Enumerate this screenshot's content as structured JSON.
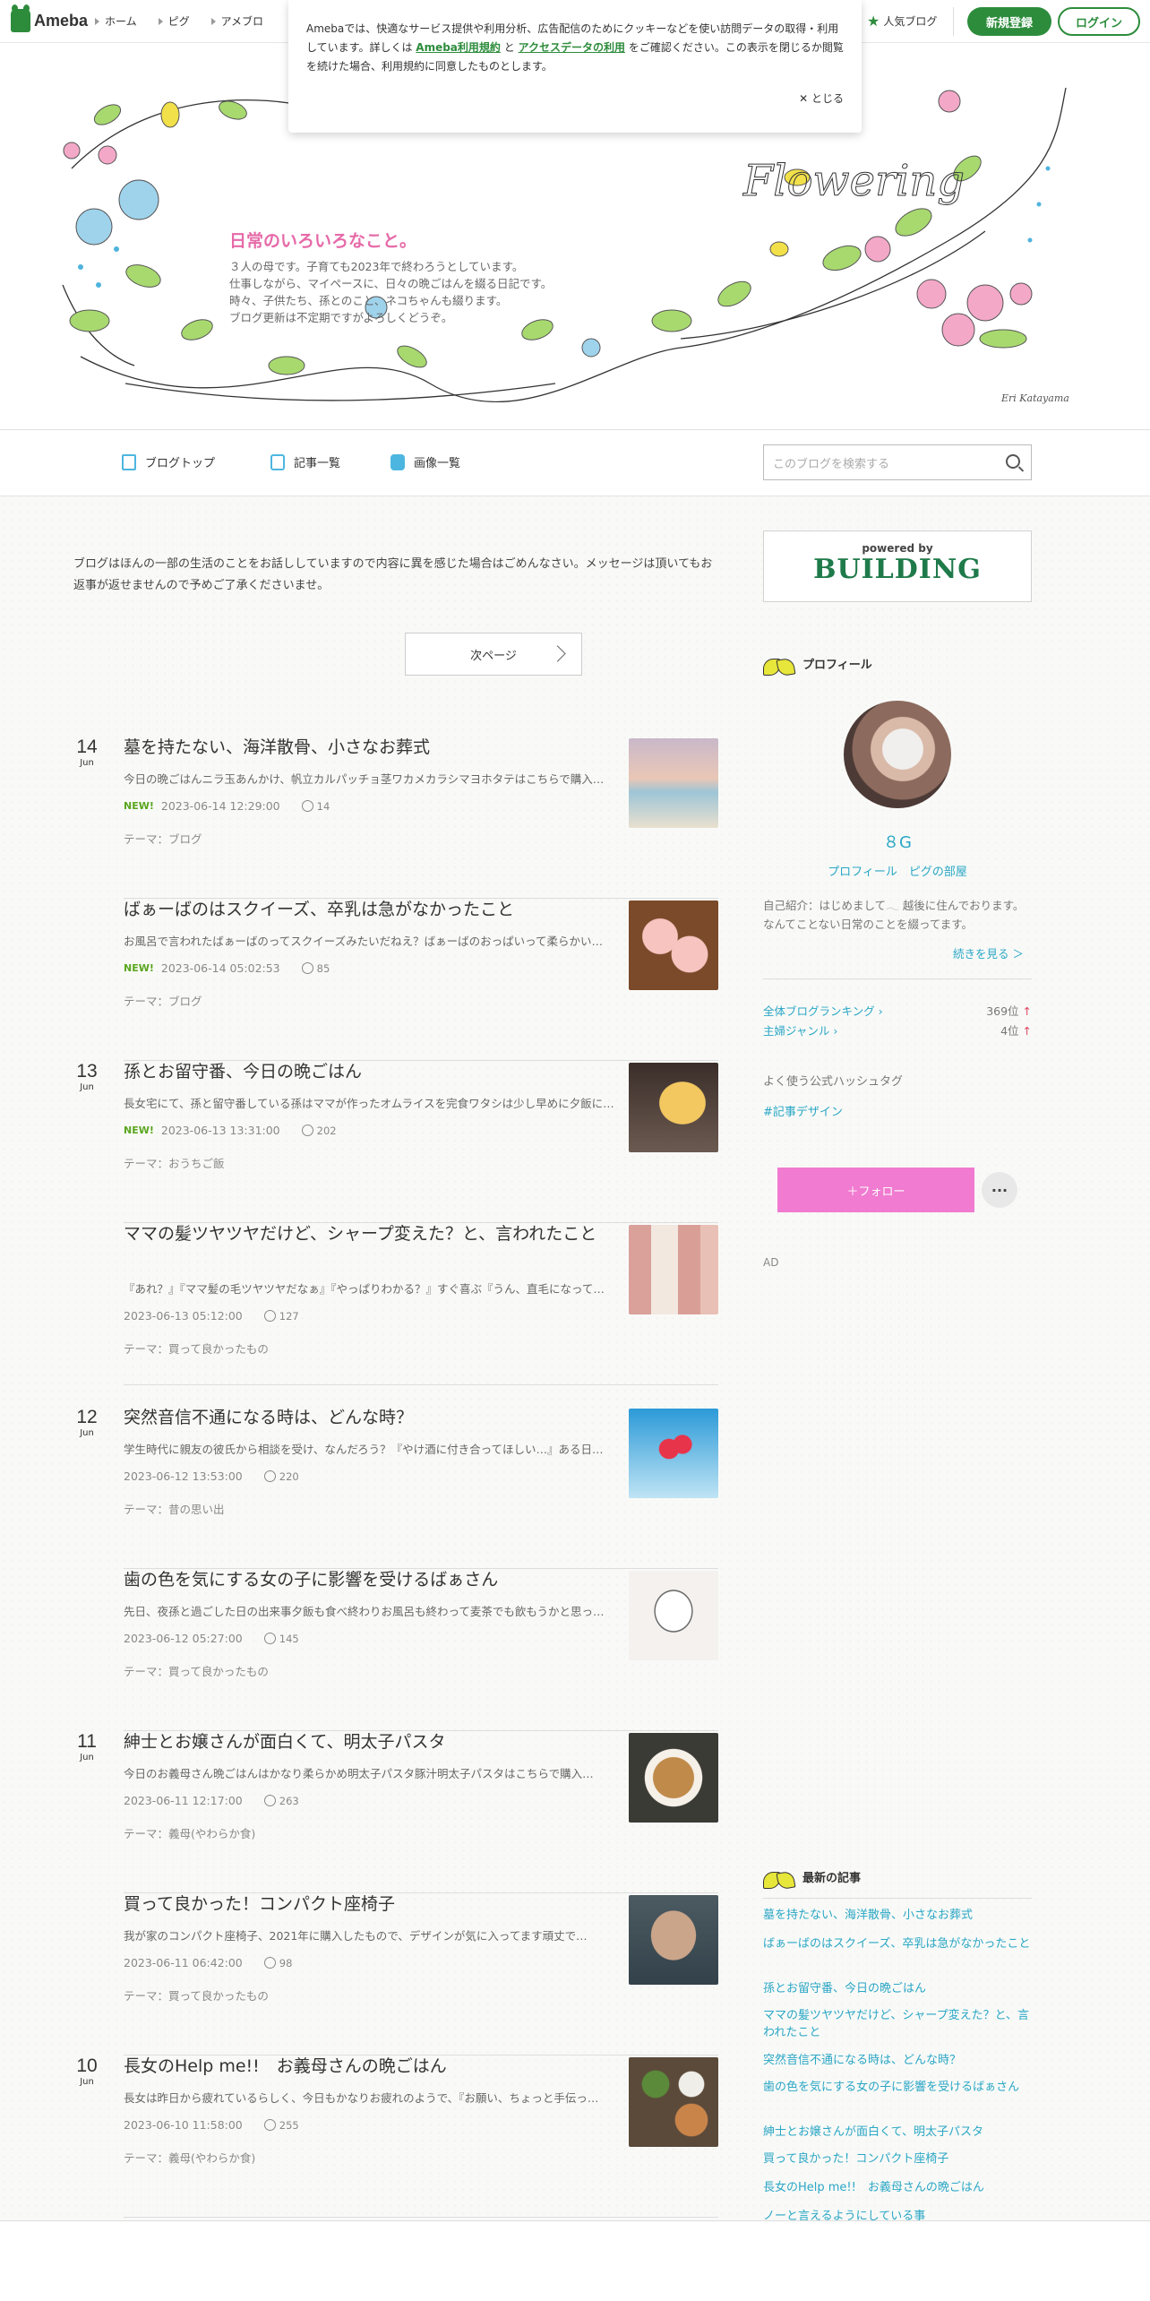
{
  "topbar": {
    "logo": "Ameba",
    "nav": [
      "ホーム",
      "ピグ",
      "アメブロ"
    ],
    "popular_blog": "人気ブログ",
    "register": "新規登録",
    "login": "ログイン"
  },
  "cookie": {
    "text_1": "Amebaでは、快適なサービス提供や利用分析、広告配信のためにクッキーなどを使い訪問データの取得・利用しています。詳しくは",
    "link_1": "Ameba利用規約",
    "and": "と",
    "link_2": "アクセスデータの利用",
    "text_2": "をご確認ください。この表示を閉じるか閲覧を続けた場合、利用規約に同意したものとします。",
    "close": "とじる"
  },
  "header": {
    "title": "日常のいろいろなこと。",
    "desc": [
      "３人の母です。子育ても2023年で終わろうとしています。",
      "仕事しながら、マイペースに、日々の晩ごはんを綴る日記です。",
      "時々、子供たち、孫とのこと、ネコちゃんも綴ります。",
      "ブログ更新は不定期ですがよろしくどうぞ。"
    ],
    "art_word": "Flowering",
    "signature": "Eri Katayama"
  },
  "blog_nav": {
    "items": [
      "ブログトップ",
      "記事一覧",
      "画像一覧"
    ],
    "search_placeholder": "このブログを検索する"
  },
  "main": {
    "notice": "ブログはほんの一部の生活のことをお話ししていますので内容に異を感じた場合はごめんなさい。メッセージは頂いてもお返事が返せませんので予めご了承くださいませ。",
    "next_page": "次ページ",
    "articles": [
      {
        "day": "14",
        "month": "Jun",
        "title": "墓を持たない、海洋散骨、小さなお葬式",
        "excerpt": "今日の晩ごはんニラ玉あんかけ、帆立カルパッチョ茎ワカメカラシマヨホタテはこちらで購入しまし…",
        "new": "NEW!",
        "datetime": "2023-06-14 12:29:00",
        "likes": "14",
        "theme": "テーマ：ブログ",
        "thumb": "sea"
      },
      {
        "day": "",
        "month": "",
        "title": "ばぁーばのはスクイーズ、卒乳は急がなかったこと",
        "excerpt": "お風呂で言われたばぁーばのってスクイーズみたいだねえ？ばぁーばのおっぱいって柔らかい…",
        "new": "NEW!",
        "datetime": "2023-06-14 05:02:53",
        "likes": "85",
        "theme": "テーマ：ブログ",
        "thumb": "pig"
      },
      {
        "day": "13",
        "month": "Jun",
        "title": "孫とお留守番、今日の晩ごはん",
        "excerpt": "長女宅にて、孫と留守番している孫はママが作ったオムライスを完食ワタシは少し早めに夕飯に…",
        "new": "NEW!",
        "datetime": "2023-06-13 13:31:00",
        "likes": "202",
        "theme": "テーマ：おうちご飯",
        "thumb": "omu"
      },
      {
        "day": "",
        "month": "",
        "title": "ママの髪ツヤツヤだけど、シャープ変えた？と、言われたこと",
        "excerpt": "『あれ？』『ママ髪の毛ツヤツヤだなぁ』『やっぱりわかる？』すぐ喜ぶ『うん、直毛になって…",
        "new": "",
        "datetime": "2023-06-13 05:12:00",
        "likes": "127",
        "theme": "テーマ：買って良かったもの",
        "thumb": "bottle"
      },
      {
        "day": "12",
        "month": "Jun",
        "title": "突然音信不通になる時は、どんな時？",
        "excerpt": "学生時代に親友の彼氏から相談を受け、なんだろう？『やけ酒に付き合ってほしい…』ある日…",
        "new": "",
        "datetime": "2023-06-12 13:53:00",
        "likes": "220",
        "theme": "テーマ：昔の思い出",
        "thumb": "balloon"
      },
      {
        "day": "",
        "month": "",
        "title": "歯の色を気にする女の子に影響を受けるばぁさん",
        "excerpt": "先日、夜孫と過ごした日の出来事夕飯も食べ終わりお風呂も終わって麦茶でも飲もうかと思った…",
        "new": "",
        "datetime": "2023-06-12 05:27:00",
        "likes": "145",
        "theme": "テーマ：買って良かったもの",
        "thumb": "tooth"
      },
      {
        "day": "11",
        "month": "Jun",
        "title": "紳士とお嬢さんが面白くて、明太子パスタ",
        "excerpt": "今日のお義母さん晩ごはんはかなり柔らかめ明太子パスタ豚汁明太子パスタはこちらで購入…",
        "new": "",
        "datetime": "2023-06-11 12:17:00",
        "likes": "263",
        "theme": "テーマ：義母(やわらか食)",
        "thumb": "pasta"
      },
      {
        "day": "",
        "month": "",
        "title": "買って良かった！コンパクト座椅子",
        "excerpt": "我が家のコンパクト座椅子、2021年に購入したもので、デザインが気に入ってます頑丈で…",
        "new": "",
        "datetime": "2023-06-11 06:42:00",
        "likes": "98",
        "theme": "テーマ：買って良かったもの",
        "thumb": "chair"
      },
      {
        "day": "10",
        "month": "Jun",
        "title": "長女のHelp me!!　お義母さんの晩ごはん",
        "excerpt": "長女は昨日から疲れているらしく、今日もかなりお疲れのようで、『お願い、ちょっと手伝っ…",
        "new": "",
        "datetime": "2023-06-10 11:58:00",
        "likes": "255",
        "theme": "テーマ：義母(やわらか食)",
        "thumb": "dinner"
      }
    ]
  },
  "sidebar": {
    "ad_building": {
      "powered": "powered by",
      "brand": "BUILDING"
    },
    "profile_heading": "プロフィール",
    "profile_name": "８G",
    "profile_links": "プロフィール　ピグの部屋",
    "intro": "自己紹介：はじめまして𓂃 越後に住んでおります。 なんてことない日常のことを綴ってます。",
    "more": "続きを見る ＞",
    "ranking": [
      {
        "label": "全体ブログランキング ›",
        "value": "369位"
      },
      {
        "label": "主婦ジャンル ›",
        "value": "4位"
      }
    ],
    "hashtag_heading": "よく使う公式ハッシュタグ",
    "hashtag": "#記事デザイン",
    "follow": "＋フォロー",
    "more_menu": "···",
    "ad_label": "AD",
    "latest_heading": "最新の記事",
    "latest": [
      "墓を持たない、海洋散骨、小さなお葬式",
      "ばぁーばのはスクイーズ、卒乳は急がなかったこと",
      "孫とお留守番、今日の晩ごはん",
      "ママの髪ツヤツヤだけど、シャープ変えた？と、言われたこと",
      "突然音信不通になる時は、どんな時？",
      "歯の色を気にする女の子に影響を受けるばぁさん",
      "紳士とお嬢さんが面白くて、明太子パスタ",
      "買って良かった！コンパクト座椅子",
      "長女のHelp me!!　お義母さんの晩ごはん",
      "ノーと言えるようにしている事"
    ]
  },
  "colors": {
    "brand": "#2d8c3c",
    "link": "#2aa6c5",
    "title_pink": "#e66aa8",
    "follow": "#f07bd0",
    "new": "#5aa61f"
  }
}
